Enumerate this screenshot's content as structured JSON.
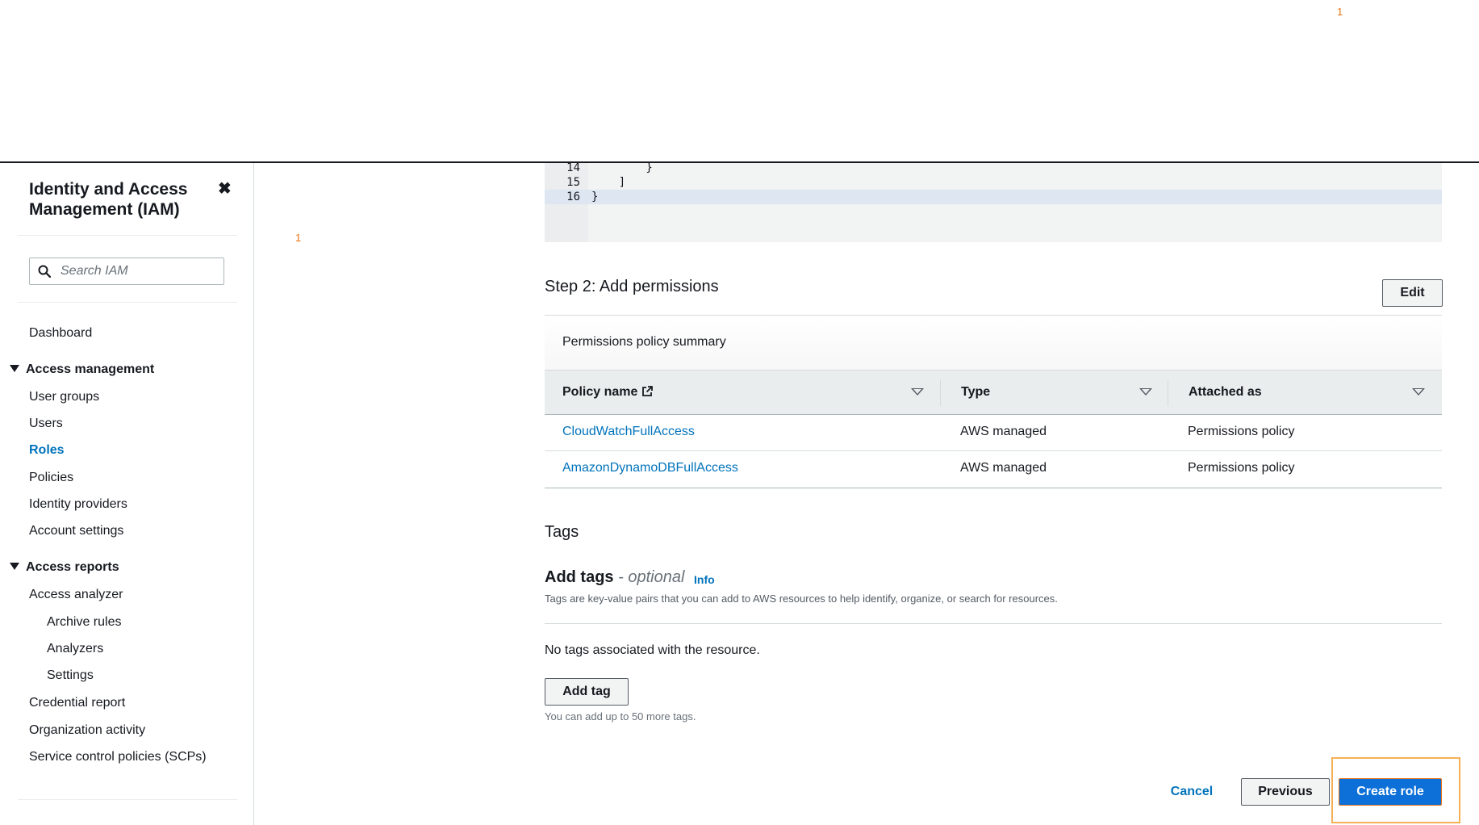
{
  "badges": {
    "top": "1",
    "middle": "1"
  },
  "sidebar": {
    "title": "Identity and Access Management (IAM)",
    "close_icon": "close-icon",
    "search": {
      "placeholder": "Search IAM",
      "value": ""
    },
    "dashboard": "Dashboard",
    "access_management": {
      "label": "Access management",
      "items": [
        "User groups",
        "Users",
        "Roles",
        "Policies",
        "Identity providers",
        "Account settings"
      ],
      "active": "Roles"
    },
    "access_reports": {
      "label": "Access reports",
      "items": [
        "Access analyzer",
        "Archive rules",
        "Analyzers",
        "Settings",
        "Credential report",
        "Organization activity",
        "Service control policies (SCPs)"
      ]
    }
  },
  "code_editor": {
    "lines": [
      {
        "number": "14",
        "text": "        }"
      },
      {
        "number": "15",
        "text": "    ]"
      },
      {
        "number": "16",
        "text": "}"
      }
    ],
    "active_line": "16"
  },
  "step2": {
    "title": "Step 2: Add permissions",
    "edit_label": "Edit",
    "summary_title": "Permissions policy summary",
    "columns": [
      "Policy name",
      "Type",
      "Attached as"
    ],
    "rows": [
      {
        "policy": "CloudWatchFullAccess",
        "type": "AWS managed",
        "attached_as": "Permissions policy"
      },
      {
        "policy": "AmazonDynamoDBFullAccess",
        "type": "AWS managed",
        "attached_as": "Permissions policy"
      }
    ]
  },
  "tags": {
    "title": "Tags",
    "add_tags_label": "Add tags",
    "optional_label": "- optional",
    "info_label": "Info",
    "description": "Tags are key-value pairs that you can add to AWS resources to help identify, organize, or search for resources.",
    "empty_text": "No tags associated with the resource.",
    "add_tag_label": "Add tag",
    "limit_text": "You can add up to 50 more tags."
  },
  "footer": {
    "cancel_label": "Cancel",
    "previous_label": "Previous",
    "create_label": "Create role"
  },
  "colors": {
    "link": "#0073bb",
    "primary_button": "#0c70d8",
    "highlight": "#f5b056",
    "badge": "#ec7211"
  }
}
